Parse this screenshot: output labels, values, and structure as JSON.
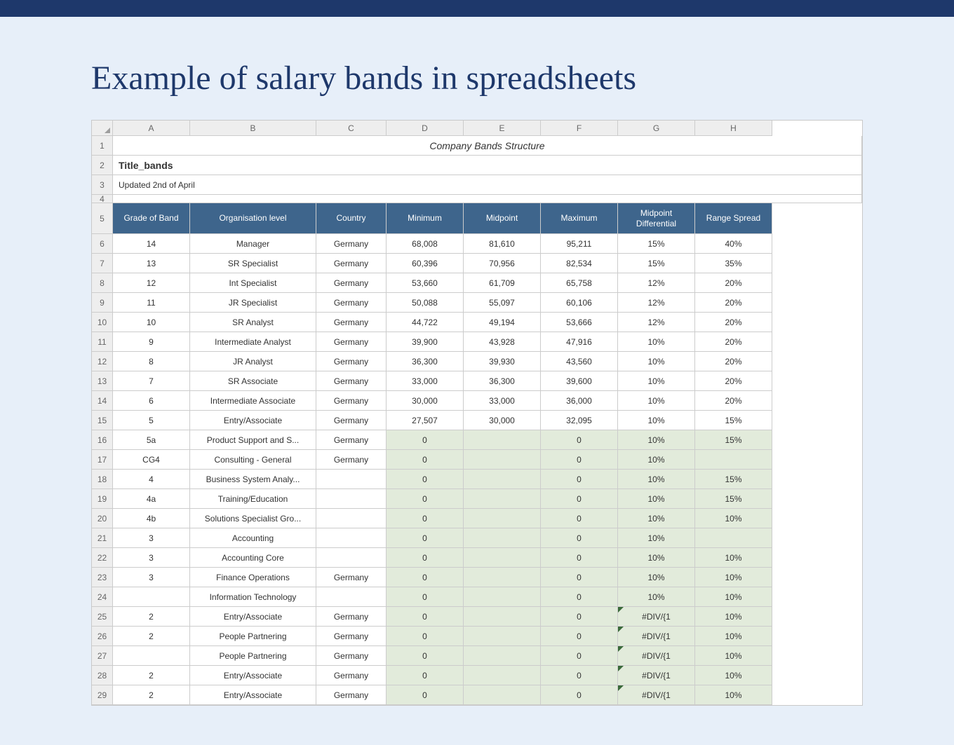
{
  "page": {
    "title": "Example of salary bands in spreadsheets"
  },
  "columns": [
    "A",
    "B",
    "C",
    "D",
    "E",
    "F",
    "G",
    "H"
  ],
  "top": {
    "row1": "Company Bands Structure",
    "row2": "Title_bands",
    "row3": "Updated 2nd of April"
  },
  "headers": {
    "A": "Grade of Band",
    "B": "Organisation level",
    "C": "Country",
    "D": "Minimum",
    "E": "Midpoint",
    "F": "Maximum",
    "G": "Midpoint Differential",
    "H": "Range Spread"
  },
  "rows": [
    {
      "n": 6,
      "A": "14",
      "B": "Manager",
      "C": "Germany",
      "D": "68,008",
      "E": "81,610",
      "F": "95,211",
      "G": "15%",
      "H": "40%"
    },
    {
      "n": 7,
      "A": "13",
      "B": "SR Specialist",
      "C": "Germany",
      "D": "60,396",
      "E": "70,956",
      "F": "82,534",
      "G": "15%",
      "H": "35%"
    },
    {
      "n": 8,
      "A": "12",
      "B": "Int Specialist",
      "C": "Germany",
      "D": "53,660",
      "E": "61,709",
      "F": "65,758",
      "G": "12%",
      "H": "20%"
    },
    {
      "n": 9,
      "A": "11",
      "B": "JR Specialist",
      "C": "Germany",
      "D": "50,088",
      "E": "55,097",
      "F": "60,106",
      "G": "12%",
      "H": "20%"
    },
    {
      "n": 10,
      "A": "10",
      "B": "SR Analyst",
      "C": "Germany",
      "D": "44,722",
      "E": "49,194",
      "F": "53,666",
      "G": "12%",
      "H": "20%"
    },
    {
      "n": 11,
      "A": "9",
      "B": "Intermediate Analyst",
      "C": "Germany",
      "D": "39,900",
      "E": "43,928",
      "F": "47,916",
      "G": "10%",
      "H": "20%"
    },
    {
      "n": 12,
      "A": "8",
      "B": "JR Analyst",
      "C": "Germany",
      "D": "36,300",
      "E": "39,930",
      "F": "43,560",
      "G": "10%",
      "H": "20%"
    },
    {
      "n": 13,
      "A": "7",
      "B": "SR Associate",
      "C": "Germany",
      "D": "33,000",
      "E": "36,300",
      "F": "39,600",
      "G": "10%",
      "H": "20%"
    },
    {
      "n": 14,
      "A": "6",
      "B": "Intermediate Associate",
      "C": "Germany",
      "D": "30,000",
      "E": "33,000",
      "F": "36,000",
      "G": "10%",
      "H": "20%"
    },
    {
      "n": 15,
      "A": "5",
      "B": "Entry/Associate",
      "C": "Germany",
      "D": "27,507",
      "E": "30,000",
      "F": "32,095",
      "G": "10%",
      "H": "15%"
    },
    {
      "n": 16,
      "A": "5a",
      "B": "Product Support and S...",
      "C": "Germany",
      "D": "0",
      "E": "",
      "F": "0",
      "G": "10%",
      "H": "15%",
      "alt": true
    },
    {
      "n": 17,
      "A": "CG4",
      "B": "Consulting - General",
      "C": "Germany",
      "D": "0",
      "E": "",
      "F": "0",
      "G": "10%",
      "H": "",
      "alt": true
    },
    {
      "n": 18,
      "A": "4",
      "B": "Business System Analy...",
      "C": "",
      "D": "0",
      "E": "",
      "F": "0",
      "G": "10%",
      "H": "15%",
      "alt": true
    },
    {
      "n": 19,
      "A": "4a",
      "B": "Training/Education",
      "C": "",
      "D": "0",
      "E": "",
      "F": "0",
      "G": "10%",
      "H": "15%",
      "alt": true
    },
    {
      "n": 20,
      "A": "4b",
      "B": "Solutions Specialist Gro...",
      "C": "",
      "D": "0",
      "E": "",
      "F": "0",
      "G": "10%",
      "H": "10%",
      "alt": true
    },
    {
      "n": 21,
      "A": "3",
      "B": "Accounting",
      "C": "",
      "D": "0",
      "E": "",
      "F": "0",
      "G": "10%",
      "H": "",
      "alt": true
    },
    {
      "n": 22,
      "A": "3",
      "B": "Accounting Core",
      "C": "",
      "D": "0",
      "E": "",
      "F": "0",
      "G": "10%",
      "H": "10%",
      "alt": true
    },
    {
      "n": 23,
      "A": "3",
      "B": "Finance Operations",
      "C": "Germany",
      "D": "0",
      "E": "",
      "F": "0",
      "G": "10%",
      "H": "10%",
      "alt": true
    },
    {
      "n": 24,
      "A": "",
      "B": "Information Technology",
      "C": "",
      "D": "0",
      "E": "",
      "F": "0",
      "G": "10%",
      "H": "10%",
      "alt": true
    },
    {
      "n": 25,
      "A": "2",
      "B": "Entry/Associate",
      "C": "Germany",
      "D": "0",
      "E": "",
      "F": "0",
      "G": "#DIV/{1",
      "H": "10%",
      "alt": true,
      "err": true
    },
    {
      "n": 26,
      "A": "2",
      "B": "People Partnering",
      "C": "Germany",
      "D": "0",
      "E": "",
      "F": "0",
      "G": "#DIV/{1",
      "H": "10%",
      "alt": true,
      "err": true
    },
    {
      "n": 27,
      "A": "",
      "B": "People Partnering",
      "C": "Germany",
      "D": "0",
      "E": "",
      "F": "0",
      "G": "#DIV/{1",
      "H": "10%",
      "alt": true,
      "err": true
    },
    {
      "n": 28,
      "A": "2",
      "B": "Entry/Associate",
      "C": "Germany",
      "D": "0",
      "E": "",
      "F": "0",
      "G": "#DIV/{1",
      "H": "10%",
      "alt": true,
      "err": true
    },
    {
      "n": 29,
      "A": "2",
      "B": "Entry/Associate",
      "C": "Germany",
      "D": "0",
      "E": "",
      "F": "0",
      "G": "#DIV/{1",
      "H": "10%",
      "alt": true,
      "err": true
    }
  ]
}
